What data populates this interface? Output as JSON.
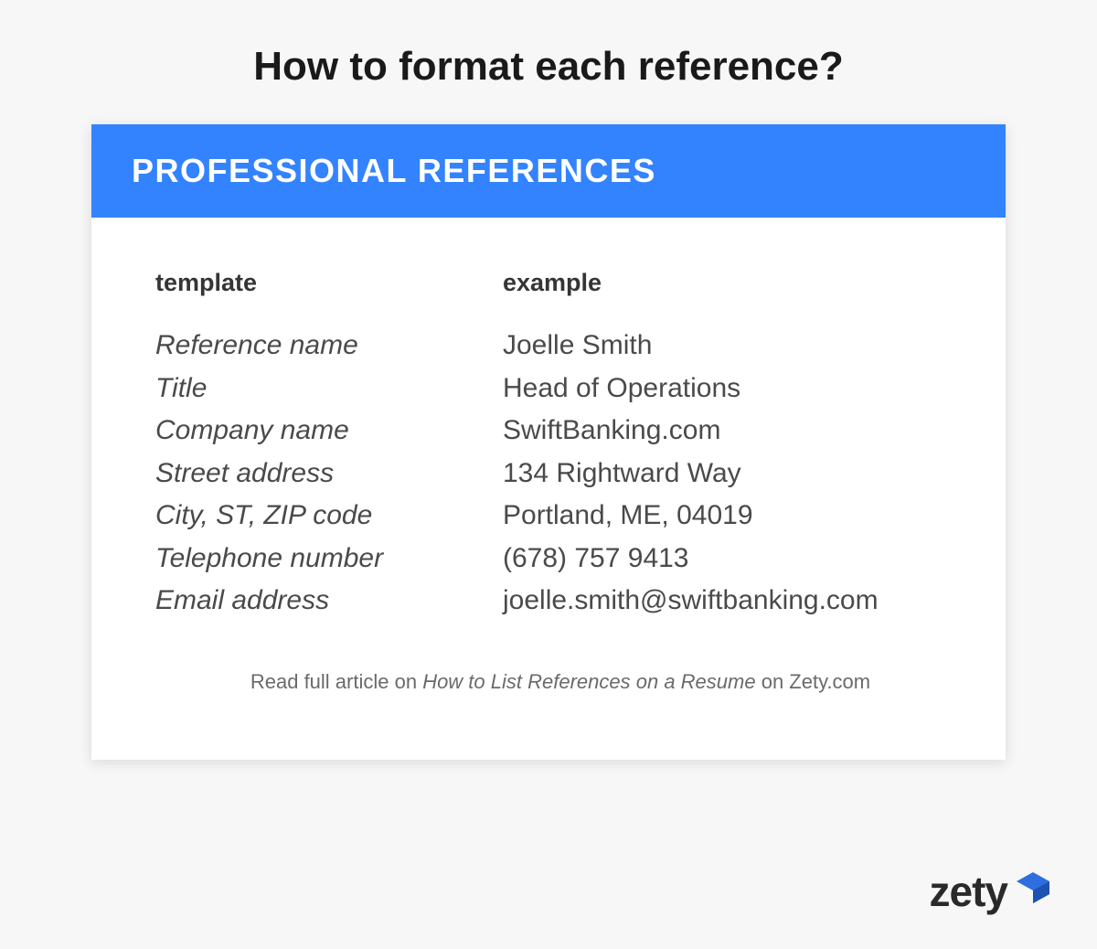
{
  "title": "How to format each reference?",
  "card": {
    "header": "PROFESSIONAL REFERENCES",
    "template": {
      "label": "template",
      "rows": [
        "Reference name",
        "Title",
        "Company name",
        "Street address",
        "City, ST, ZIP code",
        "Telephone number",
        "Email address"
      ]
    },
    "example": {
      "label": "example",
      "rows": [
        "Joelle Smith",
        "Head of Operations",
        "SwiftBanking.com",
        "134 Rightward Way",
        "Portland, ME, 04019",
        "(678) 757 9413",
        "joelle.smith@swiftbanking.com"
      ]
    }
  },
  "footer": {
    "prefix": "Read full article on ",
    "article": "How to List References on a Resume",
    "suffix": " on Zety.com"
  },
  "logo": {
    "text": "zety"
  },
  "colors": {
    "accent": "#3383ff",
    "logoMark": "#2e6fe0"
  }
}
